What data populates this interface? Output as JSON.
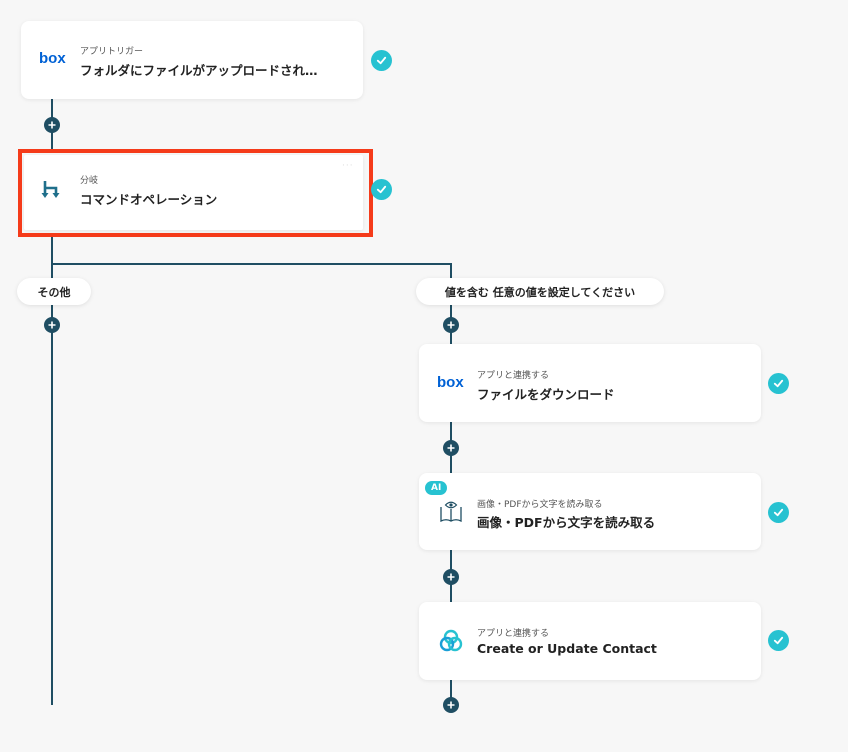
{
  "trigger": {
    "logo_text": "box",
    "subtitle": "アプリトリガー",
    "title": "フォルダにファイルがアップロードされ…"
  },
  "branch_node": {
    "subtitle": "分岐",
    "title": "コマンドオペレーション"
  },
  "branches": {
    "left_label": "その他",
    "right_label": "値を含む 任意の値を設定してください"
  },
  "steps": [
    {
      "logo_text": "box",
      "subtitle": "アプリと連携する",
      "title": "ファイルをダウンロード"
    },
    {
      "badge": "AI",
      "subtitle": "画像・PDFから文字を読み取る",
      "title": "画像・PDFから文字を読み取る"
    },
    {
      "subtitle": "アプリと連携する",
      "title": "Create or Update Contact"
    }
  ],
  "colors": {
    "connector": "#1f4e63",
    "check": "#27c2d1",
    "highlight": "#f53b1a",
    "box_brand": "#0061d5",
    "branch_icon": "#1f6f8b"
  },
  "icons": {
    "trigger": "box-logo",
    "branch": "branch-icon",
    "step1": "box-logo",
    "step2": "book-eye-icon",
    "step3": "contact-circles-icon",
    "status": "check-icon",
    "add": "plus-icon"
  }
}
